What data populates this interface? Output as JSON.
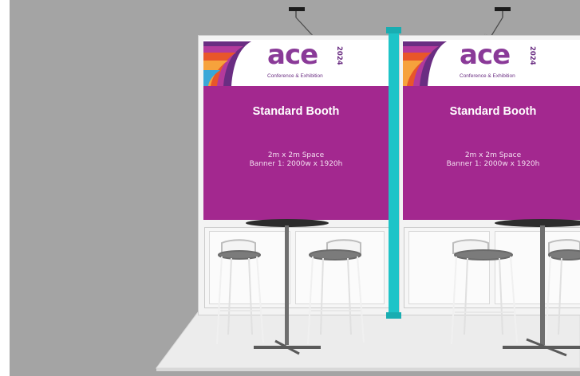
{
  "booths": [
    {
      "logo": {
        "word": "ace",
        "year": "2024",
        "tagline": "Conference & Exhibition"
      },
      "banner": {
        "title": "Standard Booth",
        "line1": "2m x 2m Space",
        "line2": "Banner 1: 2000w x 1920h"
      }
    },
    {
      "logo": {
        "word": "ace",
        "year": "2024",
        "tagline": "Conference & Exhibition"
      },
      "banner": {
        "title": "Standard Booth",
        "line1": "2m x 2m Space",
        "line2": "Banner 1: 2000w x 1920h"
      }
    }
  ],
  "colors": {
    "banner_purple": "#a3288f",
    "pillar_cyan": "#1ec4c8",
    "logo_purple": "#6a2d82",
    "logo_gradient": [
      "#6a2d82",
      "#b33a9c",
      "#e8562a",
      "#f6a23c",
      "#3aa7d8"
    ]
  },
  "icons": {
    "light": "spotlight-icon",
    "table": "bar-table-icon",
    "stool": "bar-stool-icon"
  }
}
